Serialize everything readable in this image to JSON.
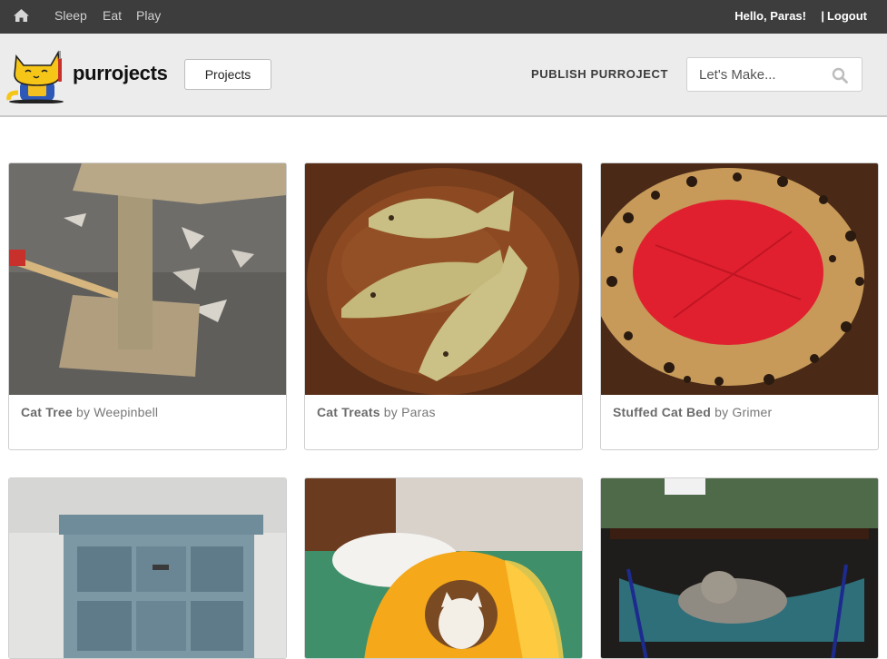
{
  "topbar": {
    "nav": [
      "Sleep",
      "Eat",
      "Play"
    ],
    "greeting": "Hello, Paras!",
    "separator": "|",
    "logout": "Logout"
  },
  "header": {
    "brand": "purrojects",
    "projects_button": "Projects",
    "publish": "PUBLISH PURROJECT",
    "search_placeholder": "Let's Make..."
  },
  "projects": [
    {
      "title": "Cat Tree",
      "by": "by",
      "author": "Weepinbell"
    },
    {
      "title": "Cat Treats",
      "by": "by",
      "author": "Paras"
    },
    {
      "title": "Stuffed Cat Bed",
      "by": "by",
      "author": "Grimer"
    },
    {
      "title": "",
      "by": "",
      "author": ""
    },
    {
      "title": "",
      "by": "",
      "author": ""
    },
    {
      "title": "",
      "by": "",
      "author": ""
    }
  ],
  "colors": {
    "topbar": "#3d3d3d",
    "header": "#ececec",
    "accent_logo": "#f5c518"
  }
}
